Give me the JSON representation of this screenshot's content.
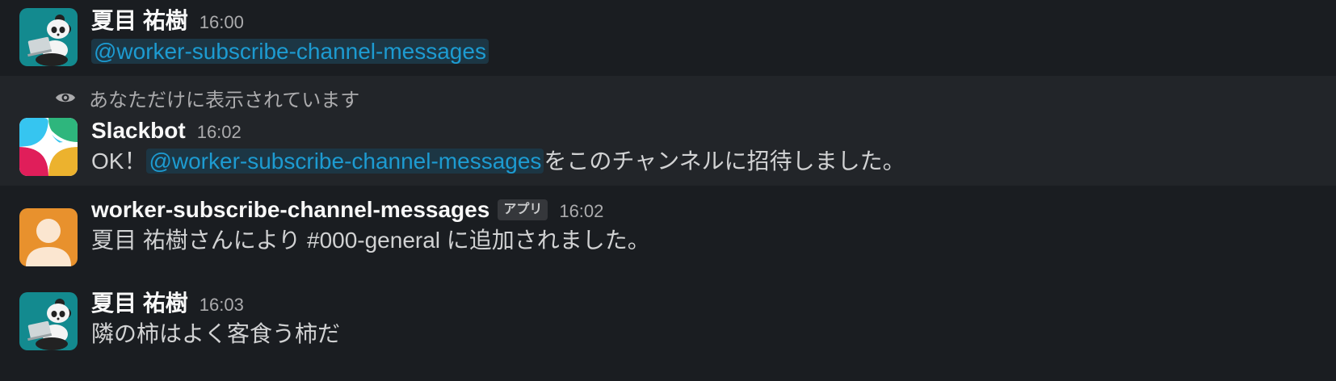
{
  "messages": [
    {
      "author": "夏目 祐樹",
      "time": "16:00",
      "mention": "@worker-subscribe-channel-messages"
    },
    {
      "ephemeral_note": "あなただけに表示されています",
      "author": "Slackbot",
      "time": "16:02",
      "prefix": "OK！",
      "mention": "@worker-subscribe-channel-messages",
      "suffix": "をこのチャンネルに招待しました。"
    },
    {
      "author": "worker-subscribe-channel-messages",
      "badge": "アプリ",
      "time": "16:02",
      "text": "夏目 祐樹さんにより #000-general に追加されました。"
    },
    {
      "author": "夏目 祐樹",
      "time": "16:03",
      "text": "隣の柿はよく客食う柿だ"
    }
  ],
  "icons": {
    "panda_avatar": "panda-avatar",
    "slackbot_avatar": "slackbot-avatar",
    "app_avatar": "user-silhouette-avatar",
    "eye": "eye-icon"
  },
  "colors": {
    "background": "#1a1d21",
    "highlight_row": "#222529",
    "mention_text": "#1d9bd1",
    "mention_bg": "#1c3644"
  }
}
